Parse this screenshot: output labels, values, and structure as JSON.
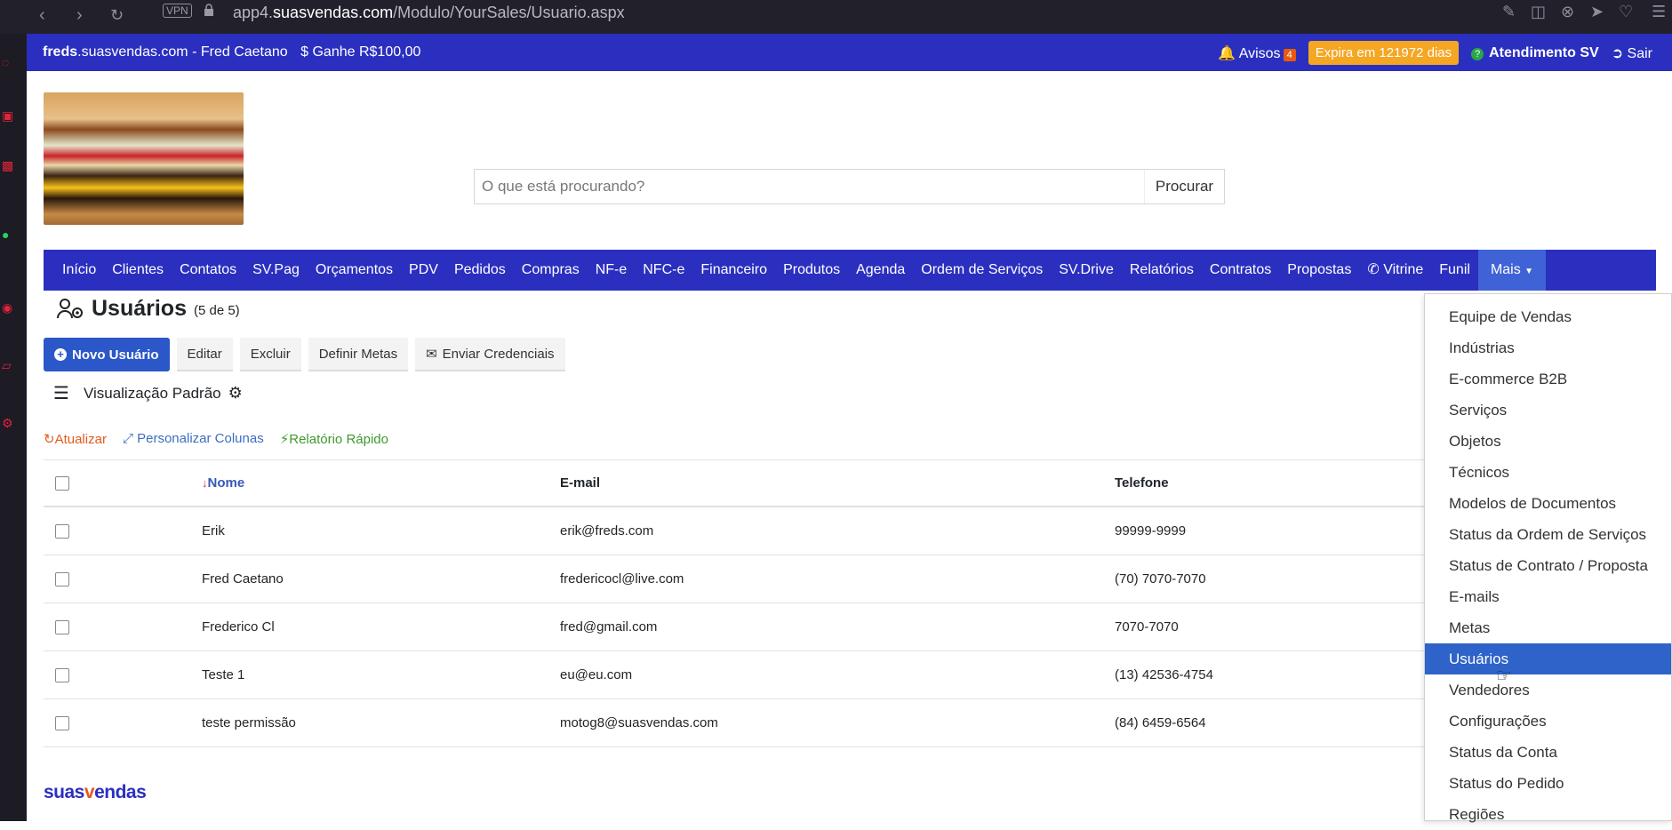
{
  "browser": {
    "vpn_label": "VPN",
    "url_host_prefix": "app4.",
    "url_host": "suasvendas.com",
    "url_path": "/Modulo/YourSales/Usuario.aspx"
  },
  "topbar": {
    "company_bold": "freds",
    "company_rest": ".suasvendas.com - Fred Caetano",
    "ganhe": "$ Ganhe R$100,00",
    "avisos_label": "Avisos",
    "avisos_count": "4",
    "expira": "Expira em 121972 dias",
    "atendimento": "Atendimento SV",
    "sair": "Sair"
  },
  "search": {
    "placeholder": "O que está procurando?",
    "button": "Procurar"
  },
  "nav": {
    "items": [
      "Início",
      "Clientes",
      "Contatos",
      "SV.Pag",
      "Orçamentos",
      "PDV",
      "Pedidos",
      "Compras",
      "NF-e",
      "NFC-e",
      "Financeiro",
      "Produtos",
      "Agenda",
      "Ordem de Serviços",
      "SV.Drive",
      "Relatórios",
      "Contratos",
      "Propostas",
      "Vitrine",
      "Funil"
    ],
    "more": "Mais"
  },
  "page": {
    "title": "Usuários",
    "count": "(5 de 5)"
  },
  "toolbar": {
    "novo": "Novo Usuário",
    "editar": "Editar",
    "excluir": "Excluir",
    "definir_metas": "Definir Metas",
    "enviar_credenciais": "Enviar Credenciais"
  },
  "view": {
    "label": "Visualização Padrão"
  },
  "links": {
    "atualizar": "Atualizar",
    "personalizar": "Personalizar Colunas",
    "relatorio": "Relatório Rápido"
  },
  "table": {
    "headers": {
      "nome": "Nome",
      "email": "E-mail",
      "telefone": "Telefone"
    },
    "rows": [
      {
        "nome": "Erik",
        "email": "erik@freds.com",
        "telefone": "99999-9999"
      },
      {
        "nome": "Fred Caetano",
        "email": "fredericocl@live.com",
        "telefone": "(70) 7070-7070"
      },
      {
        "nome": "Frederico Cl",
        "email": "fred@gmail.com",
        "telefone": "7070-7070"
      },
      {
        "nome": "Teste 1",
        "email": "eu@eu.com",
        "telefone": "(13) 42536-4754"
      },
      {
        "nome": "teste permissão",
        "email": "motog8@suasvendas.com",
        "telefone": "(84) 6459-6564"
      }
    ]
  },
  "footer": {
    "logo_a": "suas",
    "logo_v": "v",
    "logo_b": "endas"
  },
  "dropdown": {
    "items": [
      "Equipe de Vendas",
      "Indústrias",
      "E-commerce B2B",
      "Serviços",
      "Objetos",
      "Técnicos",
      "Modelos de Documentos",
      "Status da Ordem de Serviços",
      "Status de Contrato / Proposta",
      "E-mails",
      "Metas",
      "Usuários",
      "Vendedores",
      "Configurações",
      "Status da Conta",
      "Status do Pedido",
      "Regiões"
    ],
    "selected": "Usuários"
  }
}
